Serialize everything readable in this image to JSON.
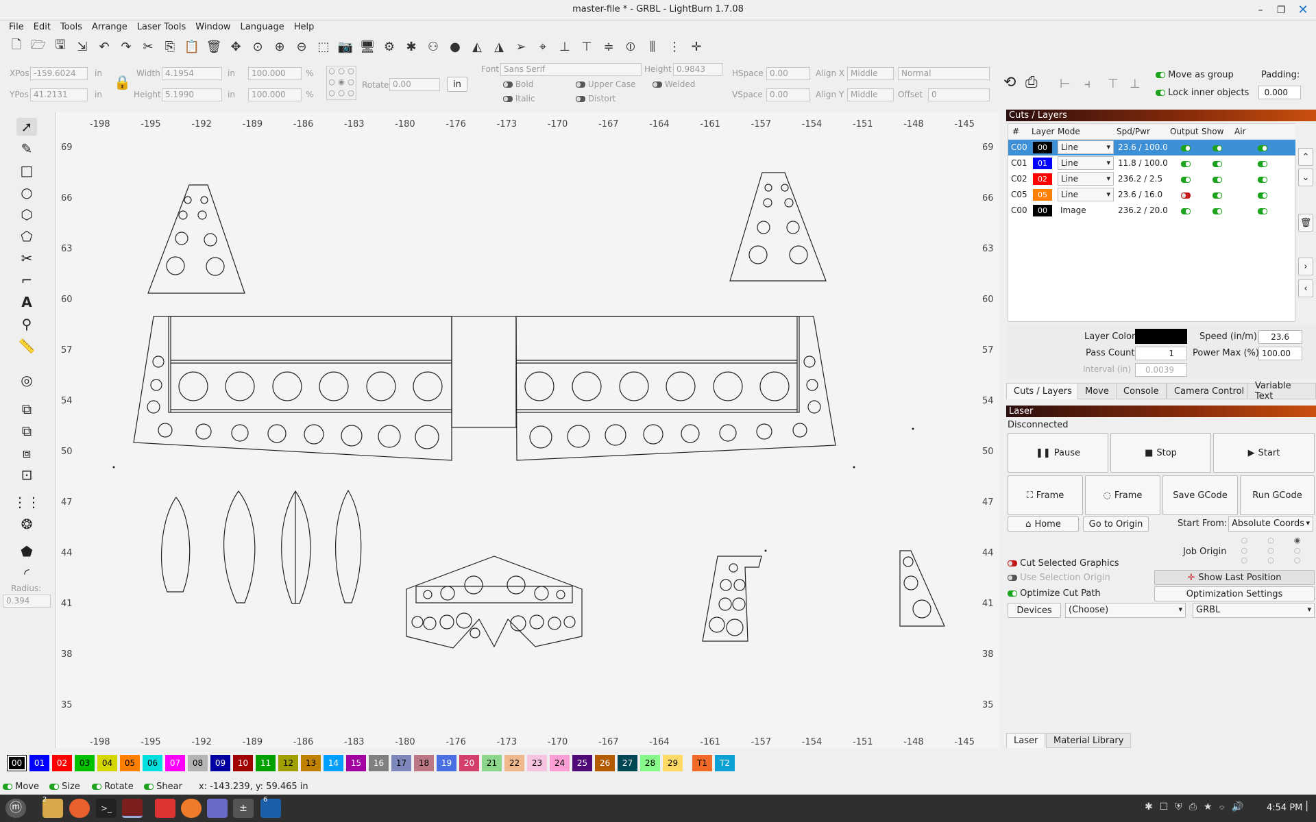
{
  "window": {
    "title": "master-file * - GRBL - LightBurn 1.7.08"
  },
  "menu": [
    "File",
    "Edit",
    "Tools",
    "Arrange",
    "Laser Tools",
    "Window",
    "Language",
    "Help"
  ],
  "props": {
    "xpos_label": "XPos",
    "xpos": "-159.6024",
    "ypos_label": "YPos",
    "ypos": "41.2131",
    "unit": "in",
    "width_label": "Width",
    "width": "4.1954",
    "height_label": "Height",
    "height": "5.1990",
    "scale_w": "100.000",
    "scale_h": "100.000",
    "pct": "%",
    "rotate_label": "Rotate",
    "rotate": "0.00",
    "unit_btn": "in",
    "font_label": "Font",
    "font": "Sans Serif",
    "theight_label": "Height",
    "theight": "0.9843",
    "bold": "Bold",
    "italic": "Italic",
    "upper": "Upper Case",
    "distort": "Distort",
    "welded": "Welded",
    "hspace_label": "HSpace",
    "hspace": "0.00",
    "vspace_label": "VSpace",
    "vspace": "0.00",
    "alignx_label": "Align X",
    "alignx": "Middle",
    "aligny_label": "Align Y",
    "aligny": "Middle",
    "normal": "Normal",
    "offset_label": "Offset",
    "offset": "0",
    "move_group": "Move as group",
    "lock_inner": "Lock inner objects",
    "padding_label": "Padding:",
    "padding": "0.000"
  },
  "left_tools": {
    "radius_label": "Radius:",
    "radius": "0.394"
  },
  "ruler": {
    "x": [
      "-198",
      "-195",
      "-192",
      "-189",
      "-186",
      "-183",
      "-180",
      "-176",
      "-173",
      "-170",
      "-167",
      "-164",
      "-161",
      "-157",
      "-154",
      "-151",
      "-148",
      "-145"
    ],
    "y": [
      "69",
      "66",
      "63",
      "60",
      "57",
      "54",
      "50",
      "47",
      "44",
      "41",
      "38",
      "35"
    ]
  },
  "cuts": {
    "title": "Cuts / Layers",
    "headers": [
      "#",
      "Layer",
      "Mode",
      "Spd/Pwr",
      "Output",
      "Show",
      "Air"
    ],
    "rows": [
      {
        "num": "C00",
        "layer": "00",
        "color": "#000000",
        "mode": "Line",
        "spd": "23.6 / 100.0",
        "out": "on"
      },
      {
        "num": "C01",
        "layer": "01",
        "color": "#0000ff",
        "mode": "Line",
        "spd": "11.8 / 100.0",
        "out": "on"
      },
      {
        "num": "C02",
        "layer": "02",
        "color": "#ff0000",
        "mode": "Line",
        "spd": "236.2 / 2.5",
        "out": "on"
      },
      {
        "num": "C05",
        "layer": "05",
        "color": "#ff8000",
        "mode": "Line",
        "spd": "23.6 / 16.0",
        "out": "red"
      },
      {
        "num": "C00",
        "layer": "00",
        "color": "#000000",
        "mode": "Image",
        "spd": "236.2 / 20.0",
        "out": "on"
      }
    ],
    "layer_color_label": "Layer Color",
    "layer_color": "#000000",
    "speed_label": "Speed (in/m)",
    "speed": "23.6",
    "pass_label": "Pass Count",
    "pass": "1",
    "power_label": "Power Max (%)",
    "power": "100.00",
    "interval_label": "Interval (in)",
    "interval": "0.0039"
  },
  "tabs": [
    "Cuts / Layers",
    "Move",
    "Console",
    "Camera Control",
    "Variable Text"
  ],
  "laser": {
    "title": "Laser",
    "status": "Disconnected",
    "pause": "Pause",
    "stop": "Stop",
    "start": "Start",
    "frame1": "Frame",
    "frame2": "Frame",
    "save": "Save GCode",
    "run": "Run GCode",
    "home": "Home",
    "origin": "Go to Origin",
    "start_from_label": "Start From:",
    "start_from": "Absolute Coords",
    "job_origin": "Job Origin",
    "cut_selected": "Cut Selected Graphics",
    "use_sel": "Use Selection Origin",
    "show_last": "Show Last Position",
    "optimize": "Optimize Cut Path",
    "opt_settings": "Optimization Settings",
    "devices": "Devices",
    "choose": "(Choose)",
    "grbl": "GRBL"
  },
  "bottom_tabs": [
    "Laser",
    "Material Library"
  ],
  "palette": [
    {
      "l": "00",
      "c": "#000000",
      "t": "#fff"
    },
    {
      "l": "01",
      "c": "#0000ff",
      "t": "#fff"
    },
    {
      "l": "02",
      "c": "#ff0000",
      "t": "#fff"
    },
    {
      "l": "03",
      "c": "#00c000",
      "t": "#000"
    },
    {
      "l": "04",
      "c": "#d6d600",
      "t": "#000"
    },
    {
      "l": "05",
      "c": "#ff8000",
      "t": "#000"
    },
    {
      "l": "06",
      "c": "#00e0e0",
      "t": "#000"
    },
    {
      "l": "07",
      "c": "#ff00ff",
      "t": "#fff"
    },
    {
      "l": "08",
      "c": "#b4b4b4",
      "t": "#000"
    },
    {
      "l": "09",
      "c": "#0000a0",
      "t": "#fff"
    },
    {
      "l": "10",
      "c": "#a00000",
      "t": "#fff"
    },
    {
      "l": "11",
      "c": "#00a000",
      "t": "#fff"
    },
    {
      "l": "12",
      "c": "#a0a000",
      "t": "#000"
    },
    {
      "l": "13",
      "c": "#c08000",
      "t": "#000"
    },
    {
      "l": "14",
      "c": "#00a0ff",
      "t": "#fff"
    },
    {
      "l": "15",
      "c": "#a000a0",
      "t": "#fff"
    },
    {
      "l": "16",
      "c": "#808080",
      "t": "#fff"
    },
    {
      "l": "17",
      "c": "#7d87b9",
      "t": "#000"
    },
    {
      "l": "18",
      "c": "#bb7784",
      "t": "#000"
    },
    {
      "l": "19",
      "c": "#4a6fe3",
      "t": "#fff"
    },
    {
      "l": "20",
      "c": "#d33f6a",
      "t": "#fff"
    },
    {
      "l": "21",
      "c": "#8cd78c",
      "t": "#000"
    },
    {
      "l": "22",
      "c": "#f0b98d",
      "t": "#000"
    },
    {
      "l": "23",
      "c": "#f6c4e1",
      "t": "#000"
    },
    {
      "l": "24",
      "c": "#fa9ed4",
      "t": "#000"
    },
    {
      "l": "25",
      "c": "#500a78",
      "t": "#fff"
    },
    {
      "l": "26",
      "c": "#b45a00",
      "t": "#fff"
    },
    {
      "l": "27",
      "c": "#004754",
      "t": "#fff"
    },
    {
      "l": "28",
      "c": "#86fa88",
      "t": "#000"
    },
    {
      "l": "29",
      "c": "#ffdb66",
      "t": "#000"
    },
    {
      "l": "T1",
      "c": "#f36926",
      "t": "#000"
    },
    {
      "l": "T2",
      "c": "#0ca0d4",
      "t": "#fff"
    }
  ],
  "status": {
    "move": "Move",
    "size": "Size",
    "rotate": "Rotate",
    "shear": "Shear",
    "coords": "x: -143.239, y: 59.465 in"
  },
  "taskbar": {
    "time": "4:54 PM",
    "badge1": "2",
    "badge2": "6"
  }
}
